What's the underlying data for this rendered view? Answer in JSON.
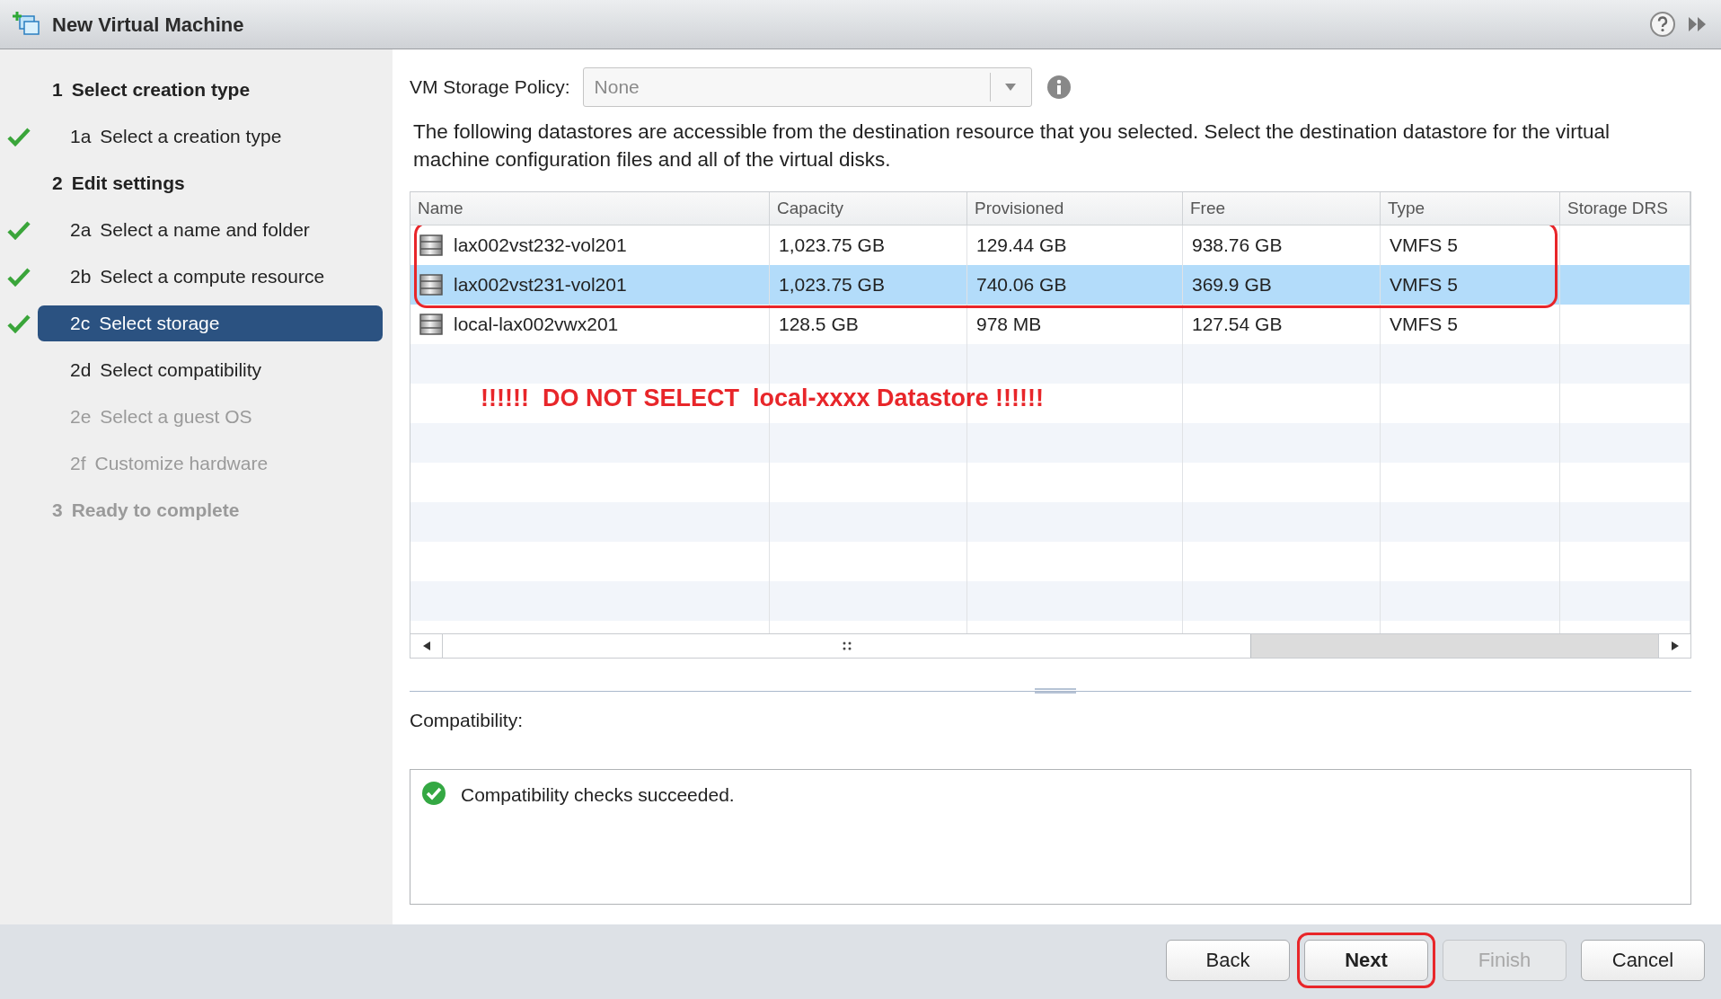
{
  "window": {
    "title": "New Virtual Machine"
  },
  "steps": [
    {
      "kind": "section",
      "number": "1",
      "label": "Select creation type",
      "done": false,
      "selected": false,
      "disabled": false
    },
    {
      "kind": "step",
      "number": "1a",
      "label": "Select a creation type",
      "done": true,
      "selected": false,
      "disabled": false
    },
    {
      "kind": "section",
      "number": "2",
      "label": "Edit settings",
      "done": false,
      "selected": false,
      "disabled": false
    },
    {
      "kind": "step",
      "number": "2a",
      "label": "Select a name and folder",
      "done": true,
      "selected": false,
      "disabled": false
    },
    {
      "kind": "step",
      "number": "2b",
      "label": "Select a compute resource",
      "done": true,
      "selected": false,
      "disabled": false
    },
    {
      "kind": "step",
      "number": "2c",
      "label": "Select storage",
      "done": true,
      "selected": true,
      "disabled": false
    },
    {
      "kind": "step",
      "number": "2d",
      "label": "Select compatibility",
      "done": false,
      "selected": false,
      "disabled": false
    },
    {
      "kind": "step",
      "number": "2e",
      "label": "Select a guest OS",
      "done": false,
      "selected": false,
      "disabled": true
    },
    {
      "kind": "step",
      "number": "2f",
      "label": "Customize hardware",
      "done": false,
      "selected": false,
      "disabled": true
    },
    {
      "kind": "section",
      "number": "3",
      "label": "Ready to complete",
      "done": false,
      "selected": false,
      "disabled": true
    }
  ],
  "storage_policy": {
    "label": "VM Storage Policy:",
    "value": "None"
  },
  "description": "The following datastores are accessible from the destination resource that you selected. Select the destination datastore for the virtual machine configuration files and all of the virtual disks.",
  "table": {
    "columns": [
      "Name",
      "Capacity",
      "Provisioned",
      "Free",
      "Type",
      "Storage DRS"
    ],
    "rows": [
      {
        "cells": [
          "lax002vst232-vol201",
          "1,023.75 GB",
          "129.44 GB",
          "938.76 GB",
          "VMFS 5"
        ],
        "selected": false,
        "highlighted": true
      },
      {
        "cells": [
          "lax002vst231-vol201",
          "1,023.75 GB",
          "740.06 GB",
          "369.9 GB",
          "VMFS 5"
        ],
        "selected": true,
        "highlighted": true
      },
      {
        "cells": [
          "local-lax002vwx201",
          "128.5 GB",
          "978 MB",
          "127.54 GB",
          "VMFS 5"
        ],
        "selected": false,
        "highlighted": false
      }
    ]
  },
  "annotation": "!!!!!!  DO NOT SELECT  local-xxxx Datastore !!!!!!",
  "compatibility": {
    "label": "Compatibility:",
    "succeeded": true,
    "message": "Compatibility checks succeeded."
  },
  "buttons": [
    {
      "label": "Back",
      "default": false,
      "disabled": false,
      "highlighted": false
    },
    {
      "label": "Next",
      "default": true,
      "disabled": false,
      "highlighted": true
    },
    {
      "label": "Finish",
      "default": false,
      "disabled": true,
      "highlighted": false
    },
    {
      "label": "Cancel",
      "default": false,
      "disabled": false,
      "highlighted": false
    }
  ]
}
